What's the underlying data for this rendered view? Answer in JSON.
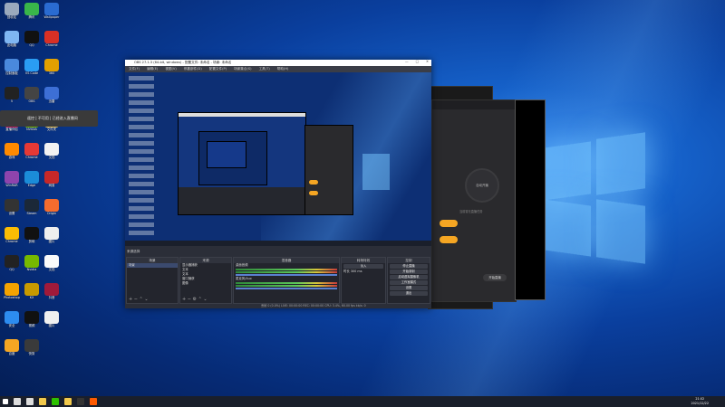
{
  "desktop": {
    "tooltip_text": "遥控 | 不可用 | 已经进入直播间",
    "icons": [
      {
        "label": "回收站",
        "color": "#9aa9bd"
      },
      {
        "label": "腾讯",
        "color": "#39b54a"
      },
      {
        "label": "Wallpaper",
        "color": "#2a6bd1"
      },
      {
        "label": "此电脑",
        "color": "#7fb6f2"
      },
      {
        "label": "QQ",
        "color": "#111"
      },
      {
        "label": "Chrome",
        "color": "#d93025"
      },
      {
        "label": "控制面板",
        "color": "#4a89dc"
      },
      {
        "label": "VS Code",
        "color": "#2a9df4"
      },
      {
        "label": "360",
        "color": "#e2a000"
      },
      {
        "label": "5",
        "color": "#222"
      },
      {
        "label": "OBS",
        "color": "#444"
      },
      {
        "label": "迅雷",
        "color": "#3d6fd6"
      },
      {
        "label": "直播伴侣",
        "color": "#c2185b"
      },
      {
        "label": "NVIDIA",
        "color": "#76b900"
      },
      {
        "label": "文件夹",
        "color": "#e8c35a"
      },
      {
        "label": "游戏",
        "color": "#ff8a00"
      },
      {
        "label": "Chrome",
        "color": "#e53935"
      },
      {
        "label": "文档",
        "color": "#f2f2f2"
      },
      {
        "label": "WinRAR",
        "color": "#8e44ad"
      },
      {
        "label": "Edge",
        "color": "#1b8cd8"
      },
      {
        "label": "网易",
        "color": "#c62828"
      },
      {
        "label": "设置",
        "color": "#333"
      },
      {
        "label": "Steam",
        "color": "#1b2838"
      },
      {
        "label": "Origin",
        "color": "#f56c2d"
      },
      {
        "label": "Chrome",
        "color": "#fbbc04"
      },
      {
        "label": "剪映",
        "color": "#111"
      },
      {
        "label": "图片",
        "color": "#eee"
      },
      {
        "label": "QQ",
        "color": "#222"
      },
      {
        "label": "Nvidia",
        "color": "#76b900"
      },
      {
        "label": "文档",
        "color": "#fafafa"
      },
      {
        "label": "Photoshop",
        "color": "#f4a300"
      },
      {
        "label": "KX",
        "color": "#c89a00"
      },
      {
        "label": "抖音",
        "color": "#a01a3a"
      },
      {
        "label": "安全",
        "color": "#2d8cf0"
      },
      {
        "label": "视频",
        "color": "#111"
      },
      {
        "label": "图片",
        "color": "#f0f0f0"
      },
      {
        "label": "百度",
        "color": "#f5a623"
      },
      {
        "label": "快剪",
        "color": "#3a3a3a"
      }
    ]
  },
  "obs": {
    "title": "OBS 27.1.3 (64-bit, windows) - 配置文件: 未命名 - 场景: 未命名",
    "menu": [
      "文件(F)",
      "编辑(E)",
      "视图(V)",
      "停靠部件(D)",
      "配置文件(P)",
      "场景集合(S)",
      "工具(T)",
      "帮助(H)"
    ],
    "window_controls": [
      "—",
      "□",
      "✕"
    ],
    "dock_header": "来源选择",
    "panels": {
      "scenes": {
        "title": "场景",
        "items": [
          "场景"
        ]
      },
      "sources": {
        "title": "来源",
        "items": [
          "显示器捕获",
          "文本",
          "文本",
          "窗口捕获",
          "图像"
        ]
      },
      "mixer": {
        "title": "混音器",
        "channels": [
          {
            "name": "桌面音频",
            "value": "0.0 dB"
          },
          {
            "name": "麦克风/Aux",
            "value": "0.0 dB"
          }
        ]
      },
      "transitions": {
        "title": "转场特效",
        "type": "淡入",
        "duration_label": "时长",
        "duration": "300 ms"
      },
      "controls": {
        "title": "控制",
        "buttons": [
          "停止直播",
          "开始录制",
          "启动虚拟摄像机",
          "工作室模式",
          "设置",
          "退出"
        ]
      }
    },
    "statusbar": "丢帧 0 (0.0%)   LIVE: 00:00:00   REC: 00:00:00   CPU: 3.4%, 60.00 fps   kb/s: 0"
  },
  "live_app": {
    "stream_label": "直播",
    "start_button": "开始直播",
    "center_circle": "自动开播",
    "hint_text": "当前暂无直播任务"
  },
  "taskbar": {
    "time": "21:02",
    "date": "2021/12/22",
    "apps": [
      {
        "name": "start",
        "color": "#fff"
      },
      {
        "name": "search",
        "color": "#ddd"
      },
      {
        "name": "task-view",
        "color": "#ddd"
      },
      {
        "name": "kuaishou",
        "color": "#f2c94c"
      },
      {
        "name": "wechat",
        "color": "#2dc100"
      },
      {
        "name": "explorer",
        "color": "#f2c94c"
      },
      {
        "name": "obs",
        "color": "#333"
      },
      {
        "name": "live",
        "color": "#ff5a00"
      }
    ]
  }
}
